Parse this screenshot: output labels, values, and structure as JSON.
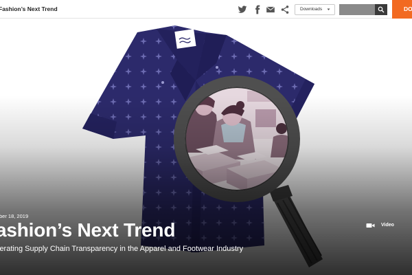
{
  "header": {
    "site_title": "Fashion’s Next Trend",
    "social": [
      "twitter-icon",
      "facebook-icon",
      "email-icon",
      "share-icon"
    ],
    "downloads_label": "Downloads",
    "search_placeholder": "",
    "donate_label": "DO"
  },
  "hero": {
    "date": "ber 18, 2019",
    "title": "ashion’s Next Trend",
    "subtitle": "lerating Supply Chain Transparency in the Apparel and Footwear Industry",
    "media_type": "Video"
  },
  "colors": {
    "accent": "#f26a21",
    "shirt": "#2c2a6b",
    "magnifier": "#4a4a4a"
  }
}
